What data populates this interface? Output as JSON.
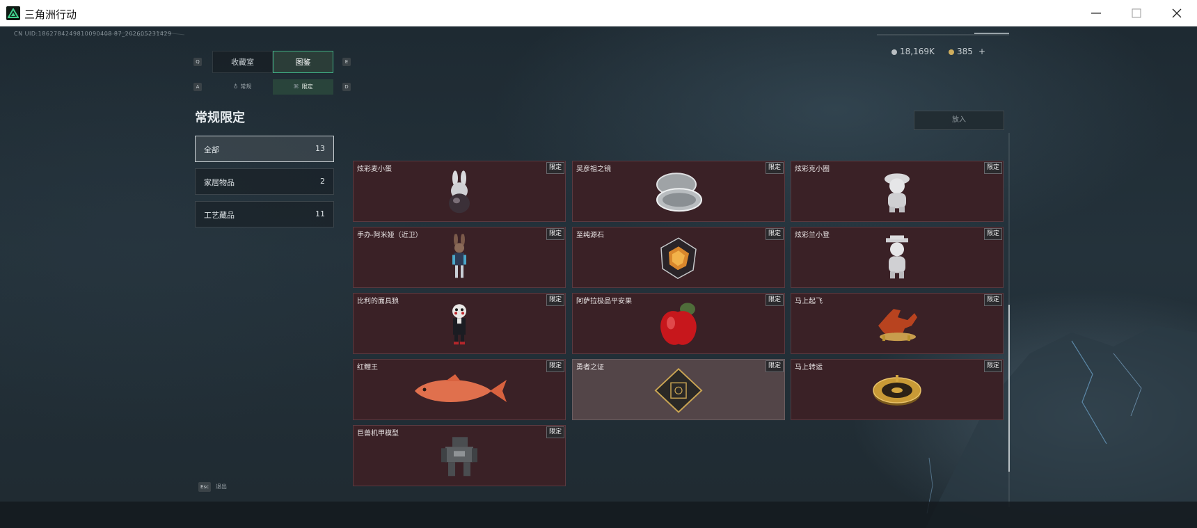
{
  "window": {
    "title": "三角洲行动"
  },
  "uid": "CN UID:1862784249810090408 87_202605231429",
  "tabs": {
    "main": [
      {
        "label": "收藏室",
        "key": "Q"
      },
      {
        "label": "图鉴",
        "key": "E"
      }
    ],
    "sub": [
      {
        "label": "常规",
        "key": "A"
      },
      {
        "label": "限定",
        "key": "D"
      }
    ]
  },
  "section_title": "常规限定",
  "categories": [
    {
      "label": "全部",
      "count": "13"
    },
    {
      "label": "家居物品",
      "count": "2"
    },
    {
      "label": "工艺藏品",
      "count": "11"
    }
  ],
  "currency": {
    "silver": "18,169K",
    "gold": "385",
    "plus": "+"
  },
  "put_button": "放入",
  "tag_label": "限定",
  "items": [
    {
      "name": "炫彩麦小蛋",
      "icon": "bunny-egg-figure-icon"
    },
    {
      "name": "吴彦祖之镜",
      "icon": "compact-mirror-icon"
    },
    {
      "name": "炫彩克小圈",
      "icon": "silver-figurine-icon"
    },
    {
      "name": "手办-阿米娅（近卫）",
      "icon": "anime-figure-icon"
    },
    {
      "name": "至纯源石",
      "icon": "crystal-stone-icon"
    },
    {
      "name": "炫彩兰小登",
      "icon": "silver-figurine-hat-icon"
    },
    {
      "name": "比利的面具狼",
      "icon": "puppet-figure-icon"
    },
    {
      "name": "阿萨拉极品平安果",
      "icon": "red-apple-icon"
    },
    {
      "name": "马上起飞",
      "icon": "horse-statue-icon"
    },
    {
      "name": "红鲤王",
      "icon": "red-carp-icon"
    },
    {
      "name": "勇者之证",
      "icon": "card-badge-icon"
    },
    {
      "name": "马上转运",
      "icon": "gold-compass-icon"
    },
    {
      "name": "巨兽机甲模型",
      "icon": "mech-model-icon"
    }
  ],
  "footer": {
    "key": "Esc",
    "label": "退出"
  },
  "colors": {
    "accent": "#3fae85",
    "card_bg": "#3a2126",
    "card_border": "#5a3a40",
    "card_dim": "#534548"
  }
}
